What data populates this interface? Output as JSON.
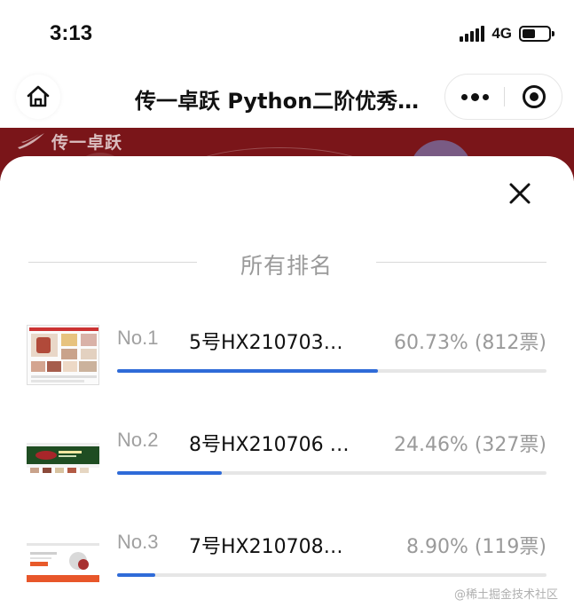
{
  "status_bar": {
    "time": "3:13",
    "network": "4G",
    "icons": [
      "signal-icon",
      "battery-icon"
    ]
  },
  "nav": {
    "title": "传一卓跃 Python二阶优秀…",
    "icons": [
      "home-icon",
      "more-icon",
      "target-icon"
    ]
  },
  "banner": {
    "logo_text": "传一卓跃",
    "background": "#7a1519"
  },
  "sheet": {
    "section_title": "所有排名",
    "close_icon": "close-icon"
  },
  "rankings": [
    {
      "rank": "No.1",
      "name": "5号HX210703…",
      "stat": "60.73% (812票)",
      "percent": 60.73,
      "votes": 812
    },
    {
      "rank": "No.2",
      "name": "8号HX210706 …",
      "stat": "24.46% (327票)",
      "percent": 24.46,
      "votes": 327
    },
    {
      "rank": "No.3",
      "name": "7号HX210708…",
      "stat": "8.90% (119票)",
      "percent": 8.9,
      "votes": 119
    }
  ],
  "colors": {
    "progress": "#2f6bd8",
    "track": "#e6e6e6",
    "muted_text": "#9a9a9a"
  },
  "watermark": "@稀土掘金技术社区"
}
